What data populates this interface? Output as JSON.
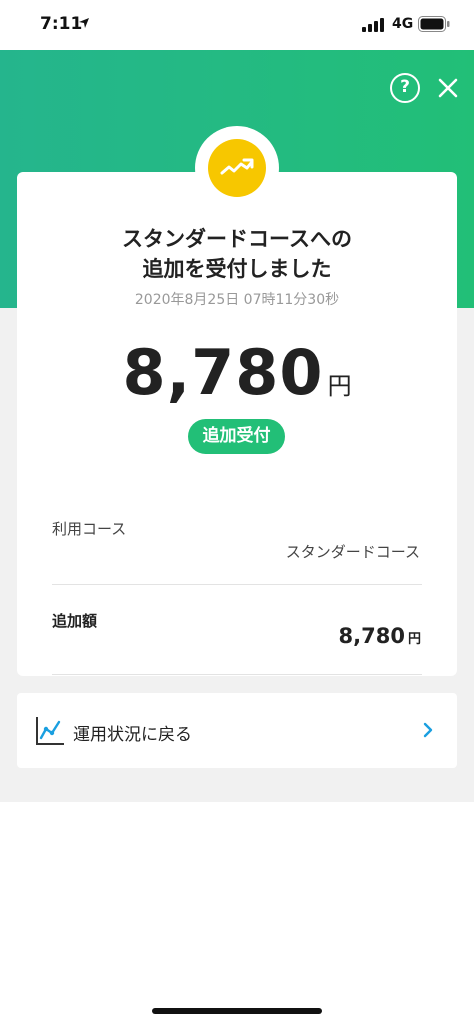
{
  "status_bar": {
    "time": "7:11",
    "network": "4G"
  },
  "header": {
    "help_label": "?"
  },
  "receipt": {
    "title_line1": "スタンダードコースへの",
    "title_line2": "追加を受付しました",
    "timestamp": "2020年8月25日 07時11分30秒",
    "amount": "8,780",
    "currency": "円",
    "status_badge": "追加受付"
  },
  "details": {
    "course_label": "利用コース",
    "course_value": "スタンダードコース",
    "added_label": "追加額",
    "added_amount": "8,780",
    "added_currency": "円"
  },
  "navigation": {
    "return_label": "運用状況に戻る"
  },
  "colors": {
    "brand_green": "#22bf77",
    "badge_yellow": "#f7c700",
    "link_blue": "#1a9fe0"
  }
}
